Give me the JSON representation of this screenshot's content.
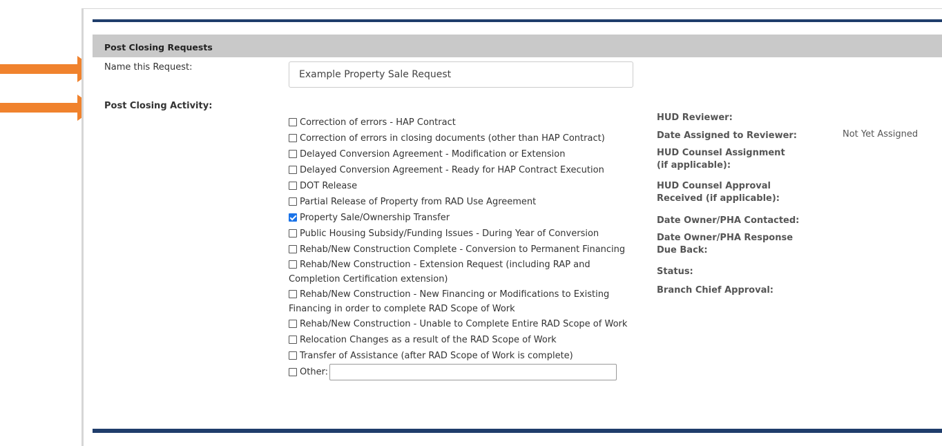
{
  "section": {
    "title": "Post Closing Requests"
  },
  "name_field": {
    "label": "Name this Request:",
    "value": "Example Property Sale Request"
  },
  "activity": {
    "label": "Post Closing Activity:",
    "options": [
      {
        "label": "Correction of errors - HAP Contract",
        "checked": false
      },
      {
        "label": "Correction of errors in closing documents (other than HAP Contract)",
        "checked": false
      },
      {
        "label": "Delayed Conversion Agreement - Modification or Extension",
        "checked": false
      },
      {
        "label": "Delayed Conversion Agreement - Ready for HAP Contract Execution",
        "checked": false
      },
      {
        "label": "DOT Release",
        "checked": false
      },
      {
        "label": "Partial Release of Property from RAD Use Agreement",
        "checked": false
      },
      {
        "label": "Property Sale/Ownership Transfer",
        "checked": true
      },
      {
        "label": "Public Housing Subsidy/Funding Issues - During Year of Conversion",
        "checked": false
      },
      {
        "label": "Rehab/New Construction Complete - Conversion to Permanent Financing",
        "checked": false
      },
      {
        "label": "Rehab/New Construction - Extension Request (including RAP and Completion Certification extension)",
        "checked": false
      },
      {
        "label": "Rehab/New Construction - New Financing or Modifications to Existing Financing in order to complete RAD Scope of Work",
        "checked": false
      },
      {
        "label": "Rehab/New Construction - Unable to Complete Entire RAD Scope of Work",
        "checked": false
      },
      {
        "label": "Relocation Changes as a result of the RAD Scope of Work",
        "checked": false
      },
      {
        "label": "Transfer of Assistance (after RAD Scope of Work is complete)",
        "checked": false
      }
    ],
    "other_label": "Other:",
    "other_value": ""
  },
  "review": {
    "hud_reviewer": "HUD Reviewer:",
    "date_assigned": "Date Assigned to Reviewer:",
    "date_assigned_value": "Not Yet Assigned",
    "counsel_assignment": "HUD Counsel Assignment (if applicable):",
    "counsel_approval": "HUD Counsel Approval Received (if applicable):",
    "date_contacted": "Date Owner/PHA Contacted:",
    "date_response": "Date Owner/PHA Response Due Back:",
    "status": "Status:",
    "branch_chief": "Branch Chief Approval:"
  },
  "colors": {
    "arrow": "#f0822d",
    "header_bar": "#1f3d6b",
    "section_bg": "#c9c9c9",
    "checkbox_checked": "#1a73e8"
  }
}
